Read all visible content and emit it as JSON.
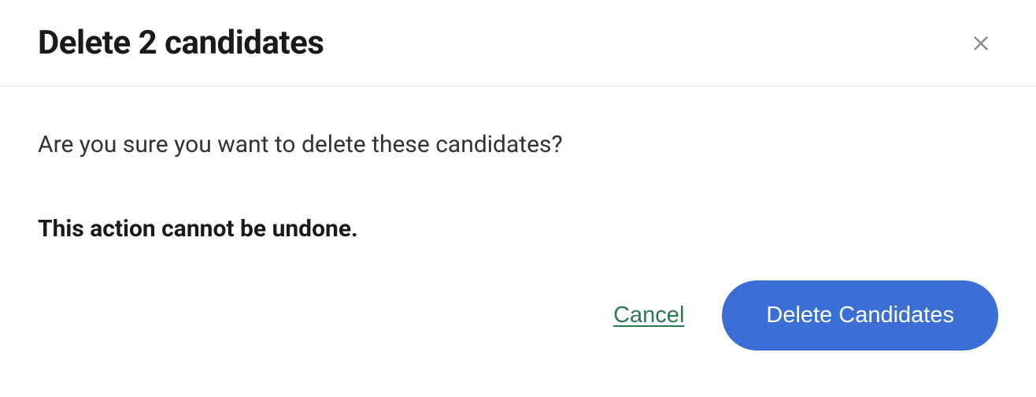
{
  "modal": {
    "title": "Delete 2 candidates",
    "body_text": "Are you sure you want to delete these candidates?",
    "warning_text": "This action cannot be undone.",
    "cancel_label": "Cancel",
    "confirm_label": "Delete Candidates"
  }
}
